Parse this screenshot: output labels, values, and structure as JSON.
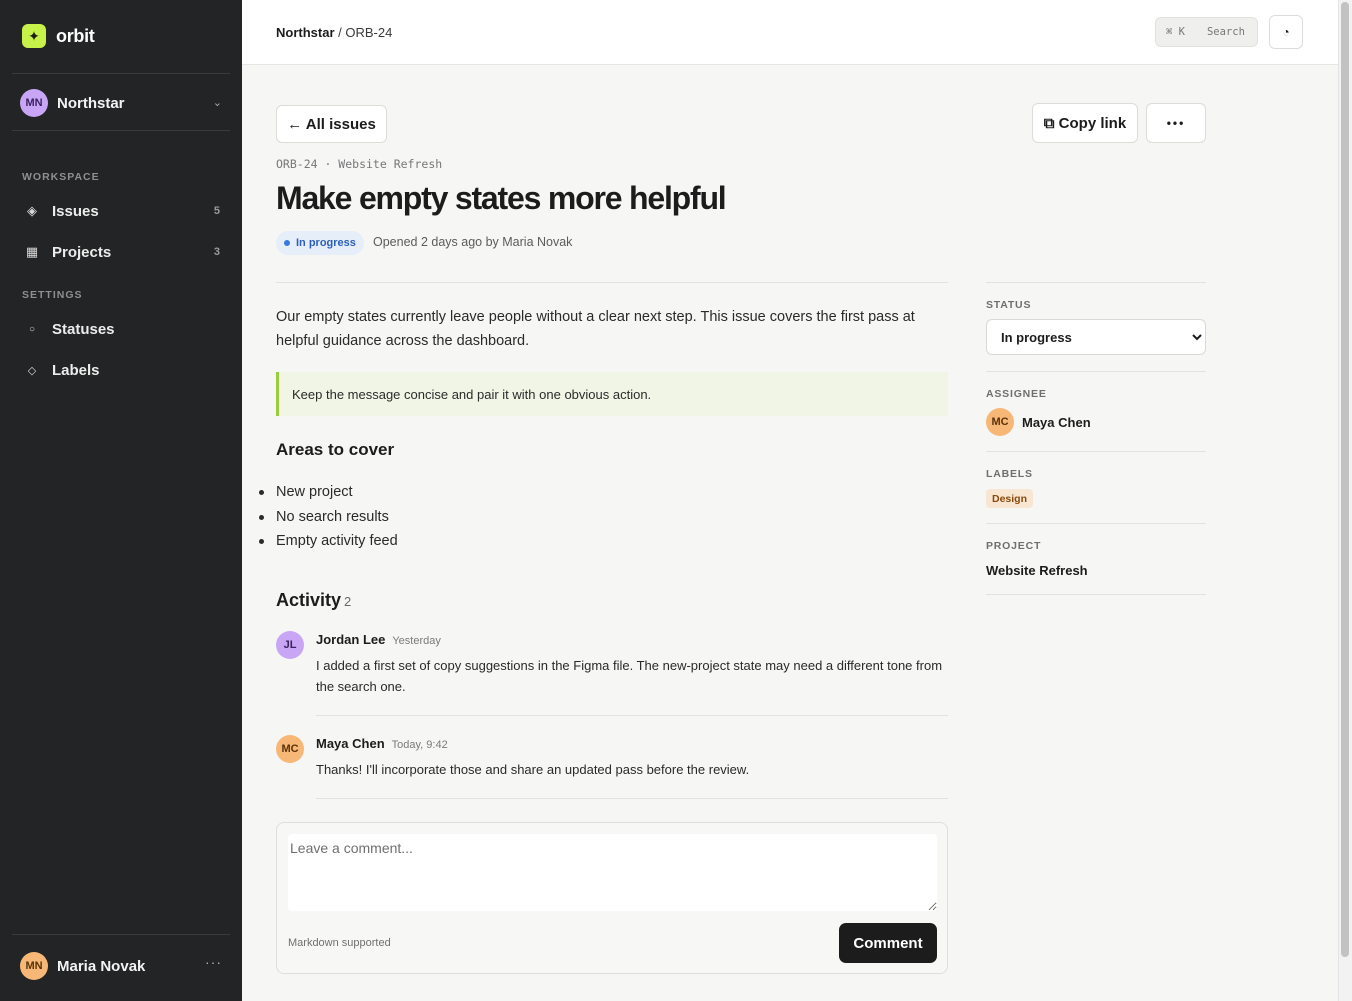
{
  "app": {
    "logo_glyph": "✦",
    "name": "orbit",
    "accent": "#c6f24a"
  },
  "workspace": {
    "initials": "MN",
    "name": "Northstar"
  },
  "sidebar": {
    "workspace_heading": "WORKSPACE",
    "settings_heading": "SETTINGS",
    "items": [
      {
        "label": "Issues",
        "count": "5",
        "icon": "diamond-icon"
      },
      {
        "label": "Projects",
        "count": "3",
        "icon": "grid-icon"
      },
      {
        "label": "Statuses",
        "icon": "circle-icon"
      },
      {
        "label": "Labels",
        "icon": "tag-icon"
      }
    ]
  },
  "user": {
    "initials": "MN",
    "name": "Maria Novak",
    "more": "···"
  },
  "topbar": {
    "breadcrumb_workspace": "Northstar",
    "breadcrumb_sep": " / ",
    "breadcrumb_issue": "ORB-24",
    "search_kbd": "⌘ K",
    "search_label": "Search",
    "theme_glyph": "◔"
  },
  "issue": {
    "back_label": "← All issues",
    "copy_link_label": "⧉ Copy link",
    "more_label": "•••",
    "meta": "ORB-24 · Website Refresh",
    "title": "Make empty states more helpful",
    "status": "In progress",
    "opened": "Opened 2 days ago by Maria Novak",
    "description": "Our empty states currently leave people without a clear next step. This issue covers the first pass at helpful guidance across the dashboard.",
    "callout": "Keep the message concise and pair it with one obvious action.",
    "areas_heading": "Areas to cover",
    "areas": [
      "New project",
      "No search results",
      "Empty activity feed"
    ]
  },
  "activity": {
    "heading": "Activity",
    "count": "2",
    "comments": [
      {
        "initials": "JL",
        "author": "Jordan Lee",
        "time": "Yesterday",
        "body": "I added a first set of copy suggestions in the Figma file. The new-project state may need a different tone from the search one."
      },
      {
        "initials": "MC",
        "author": "Maya Chen",
        "time": "Today, 9:42",
        "body": "Thanks! I'll incorporate those and share an updated pass before the review."
      }
    ]
  },
  "composer": {
    "placeholder": "Leave a comment...",
    "note": "Markdown supported",
    "submit_label": "Comment"
  },
  "details": {
    "status_label": "STATUS",
    "status_value": "In progress",
    "assignee_label": "ASSIGNEE",
    "assignee_initials": "MC",
    "assignee_name": "Maya Chen",
    "labels_label": "LABELS",
    "label_value": "Design",
    "project_label": "PROJECT",
    "project_value": "Website Refresh"
  }
}
